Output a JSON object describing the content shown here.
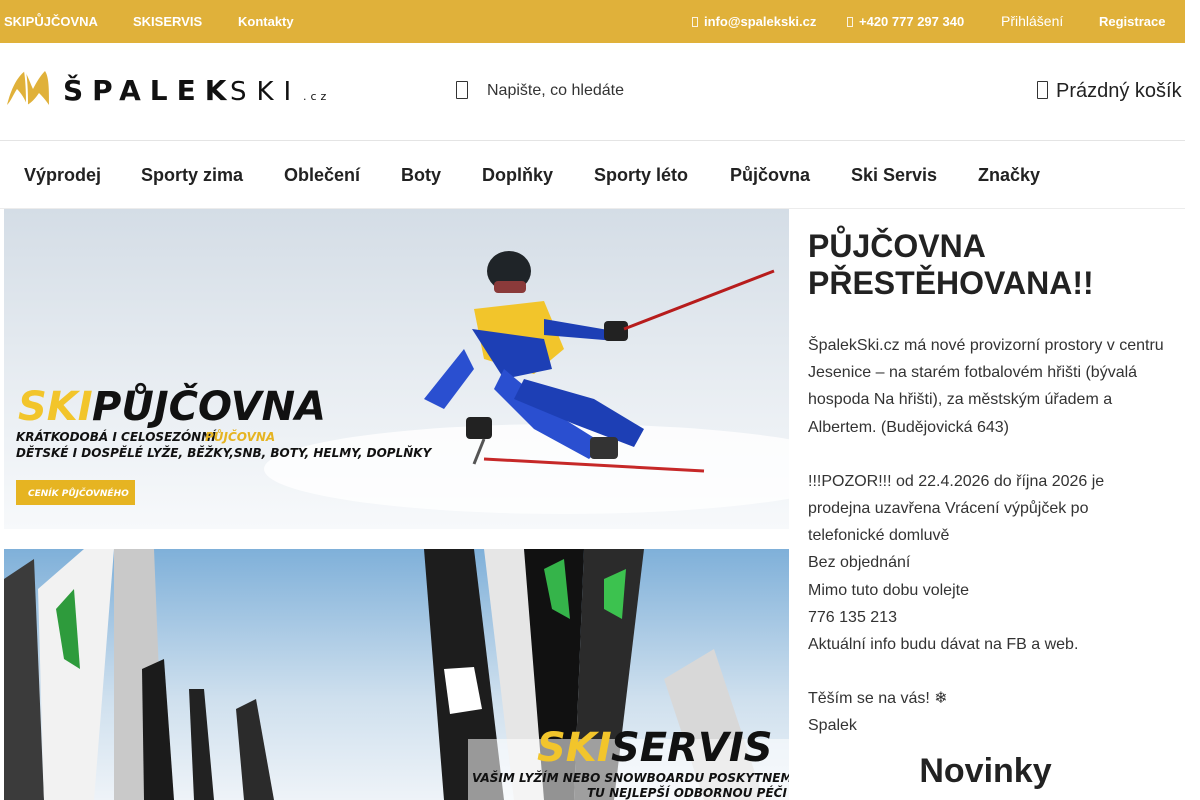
{
  "topbar": {
    "links": [
      "SKIPŮJČOVNA",
      "SKISERVIS",
      "Kontakty"
    ],
    "email": "info@spalekski.cz",
    "phone": "+420 777 297 340",
    "login": "Přihlášení",
    "register": "Registrace",
    "email_icon": "envelope-icon",
    "phone_icon": "phone-icon"
  },
  "header": {
    "logo_main": "ŠPALEK",
    "logo_sub": "SKI",
    "logo_tld": ".cz",
    "search_placeholder": "Napište, co hledáte",
    "search_icon": "search-icon",
    "cart_label": "Prázdný košík",
    "cart_icon": "cart-icon"
  },
  "nav": {
    "items": [
      "Výprodej",
      "Sporty zima",
      "Oblečení",
      "Boty",
      "Doplňky",
      "Sporty léto",
      "Půjčovna",
      "Ski Servis",
      "Značky"
    ]
  },
  "banner_rental": {
    "title_ski": "SKI",
    "title_rest": "PŮJČOVNA",
    "line1_a": "KRÁTKODOBÁ I CELOSEZÓNNÍ ",
    "line1_b": "PŮJČOVNA",
    "line2": "DĚTSKÉ I DOSPĚLÉ LYŽE, BĚŽKY,SNB, BOTY, HELMY, DOPLŇKY",
    "button": "CENÍK PŮJČOVNÉHO"
  },
  "banner_service": {
    "title_ski": "SKI",
    "title_rest": "SERVIS",
    "line1": "VAŠIM LYŽÍM NEBO SNOWBOARDU POSKYTNEME",
    "line2": "TU NEJLEPŠÍ ODBORNOU PÉČI"
  },
  "announcement": {
    "title": "PŮJČOVNA PŘESTĚHOVANA!! ",
    "paragraph1": "ŠpalekSki.cz má nové provizorní prostory v centru Jesenice – na starém fotbalovém hřišti (bývalá hospoda Na hřišti), za městským úřadem a Albertem. (Budějovická 643)",
    "line_pozor": "!!!POZOR!!! od 22.4.2026 do října 2026 je prodejna uzavřena  Vrácení výpůjček po telefonické domluvě",
    "line_bez": " Bez objednání",
    "line_mimo": " Mimo tuto dobu volejte",
    "line_phone": "776 135 213",
    "line_fb": "Aktuální info budu dávat na FB a web.",
    "line_thanks": "Těším se na vás! ❄",
    "signature": "Spalek"
  },
  "novinky": "Novinky",
  "colors": {
    "brand": "#e0b13a",
    "accent_yellow": "#f2c52b",
    "text": "#222222"
  }
}
